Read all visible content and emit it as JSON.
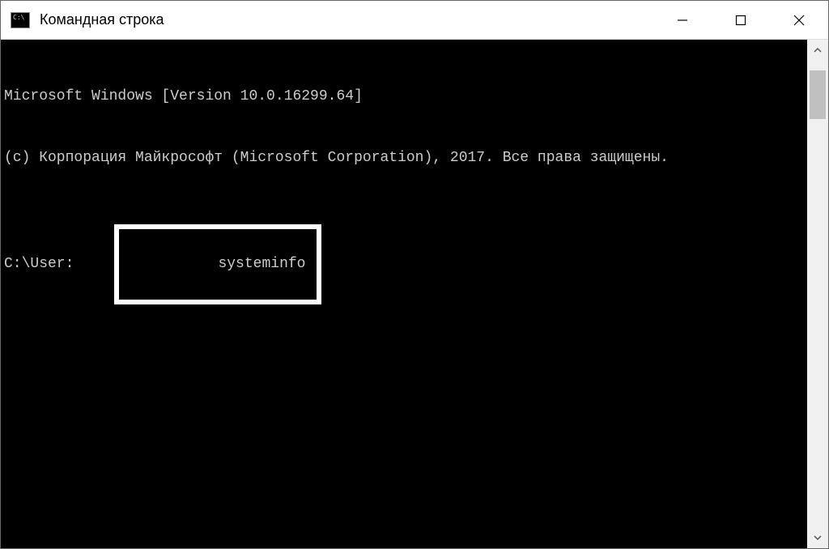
{
  "window": {
    "title": "Командная строка",
    "icon_text": "C:\\"
  },
  "terminal": {
    "line1": "Microsoft Windows [Version 10.0.16299.64]",
    "line2": "(c) Корпорация Майкрософт (Microsoft Corporation), 2017. Все права защищены.",
    "prompt": "C:\\User:",
    "command": "systeminfo"
  }
}
